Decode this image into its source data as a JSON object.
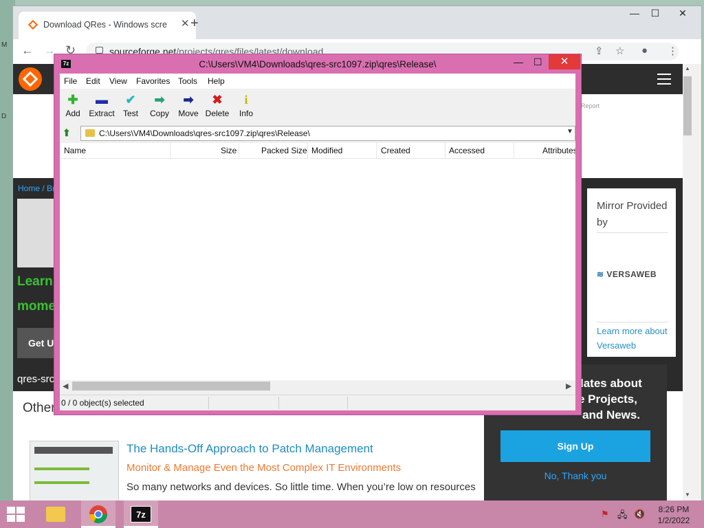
{
  "desktop": {
    "glyphs": [
      "M",
      "D"
    ]
  },
  "browser": {
    "tab_title": "Download QRes - Windows scre",
    "new_tab": "+",
    "window_controls": {
      "minimize": "—",
      "maximize": "☐",
      "close": "✕"
    },
    "nav": {
      "back": "←",
      "forward": "→",
      "reload": "↻"
    },
    "url_host": "sourceforge.net",
    "url_path": "/projects/qres/files/latest/download"
  },
  "page": {
    "breadcrumb": "Home / Br",
    "learn": "Learn",
    "moment": "mome",
    "get_button": "Get U",
    "project_label": "qres-src",
    "other_heading": "Other",
    "report": "Report",
    "mirror": {
      "title": "Mirror Provided by",
      "logo_text": "VERSAWEB",
      "learn_more": "Learn more about Versaweb"
    },
    "newsletter": {
      "line1": "lates about",
      "line2": "e Projects,",
      "line3": "and News.",
      "signup": "Sign Up",
      "no_thanks": "No, Thank you"
    },
    "ad": {
      "title": "The Hands-Off Approach to Patch Management",
      "subtitle": "Monitor & Manage Even the Most Complex IT Environments",
      "body": "So many networks and devices. So little time. When you’re low on resources"
    }
  },
  "zip": {
    "app_icon": "7z",
    "title": "C:\\Users\\VM4\\Downloads\\qres-src1097.zip\\qres\\Release\\",
    "controls": {
      "minimize": "—",
      "maximize": "☐",
      "close": "✕"
    },
    "menu": [
      "File",
      "Edit",
      "View",
      "Favorites",
      "Tools",
      "Help"
    ],
    "toolbar": [
      {
        "label": "Add",
        "icon": "add-icon",
        "glyph": "✚",
        "color": "#2fb52f"
      },
      {
        "label": "Extract",
        "icon": "extract-icon",
        "glyph": "▬",
        "color": "#1e2fa8"
      },
      {
        "label": "Test",
        "icon": "test-icon",
        "glyph": "✔",
        "color": "#27b7c2"
      },
      {
        "label": "Copy",
        "icon": "copy-icon",
        "glyph": "➡",
        "color": "#21a37a"
      },
      {
        "label": "Move",
        "icon": "move-icon",
        "glyph": "➡",
        "color": "#1a2a8a"
      },
      {
        "label": "Delete",
        "icon": "delete-icon",
        "glyph": "✖",
        "color": "#d41c1c"
      },
      {
        "label": "Info",
        "icon": "info-icon",
        "glyph": "i",
        "color": "#c9b400"
      }
    ],
    "address": "C:\\Users\\VM4\\Downloads\\qres-src1097.zip\\qres\\Release\\",
    "columns": [
      "Name",
      "Size",
      "Packed Size",
      "Modified",
      "Created",
      "Accessed",
      "Attributes"
    ],
    "status": "0 / 0 object(s) selected"
  },
  "taskbar": {
    "zip_label": "7z",
    "time": "8:26 PM",
    "date": "1/2/2022"
  }
}
